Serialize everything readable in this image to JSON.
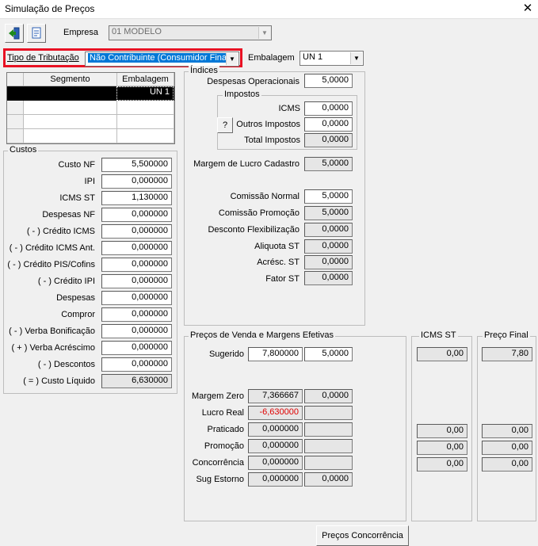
{
  "window": {
    "title": "Simulação de Preços"
  },
  "toolbar": {
    "empresa_label": "Empresa",
    "empresa_value": "01 MODELO"
  },
  "tributacao": {
    "label": "Tipo de Tributação",
    "value": "Não Contribuinte (Consumidor Final)",
    "highlight_color": "#e81123"
  },
  "embalagem": {
    "label": "Embalagem",
    "value": "UN  1"
  },
  "grid": {
    "headers": [
      "Segmento",
      "Embalagem"
    ],
    "rows": [
      {
        "segmento": "",
        "embalagem": "UN  1"
      }
    ]
  },
  "indices": {
    "title": "Índices",
    "despesas_operacionais": {
      "label": "Despesas Operacionais",
      "value": "5,0000"
    },
    "impostos": {
      "title": "Impostos",
      "icms": {
        "label": "ICMS",
        "value": "0,0000"
      },
      "help_button": "?",
      "outros": {
        "label": "Outros Impostos",
        "value": "0,0000"
      },
      "total": {
        "label": "Total Impostos",
        "value": "0,0000"
      }
    },
    "margem_lucro_cadastro": {
      "label": "Margem de Lucro Cadastro",
      "value": "5,0000"
    },
    "comissao_normal": {
      "label": "Comissão Normal",
      "value": "5,0000"
    },
    "comissao_promocao": {
      "label": "Comissão Promoção",
      "value": "5,0000"
    },
    "desconto_flex": {
      "label": "Desconto Flexibilização",
      "value": "0,0000"
    },
    "aliquota_st": {
      "label": "Aliquota ST",
      "value": "0,0000"
    },
    "acresc_st": {
      "label": "Acrésc. ST",
      "value": "0,0000"
    },
    "fator_st": {
      "label": "Fator ST",
      "value": "0,0000"
    }
  },
  "custos": {
    "title": "Custos",
    "items": [
      {
        "label": "Custo NF",
        "value": "5,500000"
      },
      {
        "label": "IPI",
        "value": "0,000000"
      },
      {
        "label": "ICMS ST",
        "value": "1,130000"
      },
      {
        "label": "Despesas NF",
        "value": "0,000000"
      },
      {
        "label": "( - ) Crédito ICMS",
        "value": "0,000000"
      },
      {
        "label": "( - ) Crédito ICMS Ant.",
        "value": "0,000000"
      },
      {
        "label": "( - ) Crédito PIS/Cofins",
        "value": "0,000000"
      },
      {
        "label": "( - ) Crédito IPI",
        "value": "0,000000"
      },
      {
        "label": "Despesas",
        "value": "0,000000"
      },
      {
        "label": "Compror",
        "value": "0,000000"
      },
      {
        "label": "( - ) Verba Bonificação",
        "value": "0,000000"
      },
      {
        "label": "( + ) Verba Acréscimo",
        "value": "0,000000"
      },
      {
        "label": "( - ) Descontos",
        "value": "0,000000"
      },
      {
        "label": "( = ) Custo Líquido",
        "value": "6,630000"
      }
    ]
  },
  "precos": {
    "title": "Preços de Venda e Margens Efetivas",
    "sugerido": {
      "label": "Sugerido",
      "value1": "7,800000",
      "value2": "5,0000"
    },
    "margem_zero": {
      "label": "Margem Zero",
      "value1": "7,366667",
      "value2": "0,0000"
    },
    "lucro_real": {
      "label": "Lucro Real",
      "value1": "-6,630000",
      "value2": ""
    },
    "praticado": {
      "label": "Praticado",
      "value1": "0,000000",
      "value2": ""
    },
    "promocao": {
      "label": "Promoção",
      "value1": "0,000000",
      "value2": ""
    },
    "concorrencia": {
      "label": "Concorrência",
      "value1": "0,000000",
      "value2": ""
    },
    "sug_estorno": {
      "label": "Sug Estorno",
      "value1": "0,000000",
      "value2": "0,0000"
    }
  },
  "icms_st": {
    "title": "ICMS ST",
    "sugerido": "0,00",
    "praticado": "0,00",
    "promocao": "0,00",
    "concorrencia": "0,00"
  },
  "preco_final": {
    "title": "Preço Final",
    "sugerido": "7,80",
    "praticado": "0,00",
    "promocao": "0,00",
    "concorrencia": "0,00"
  },
  "buttons": {
    "precos_concorrencia": "Preços Concorrência"
  }
}
